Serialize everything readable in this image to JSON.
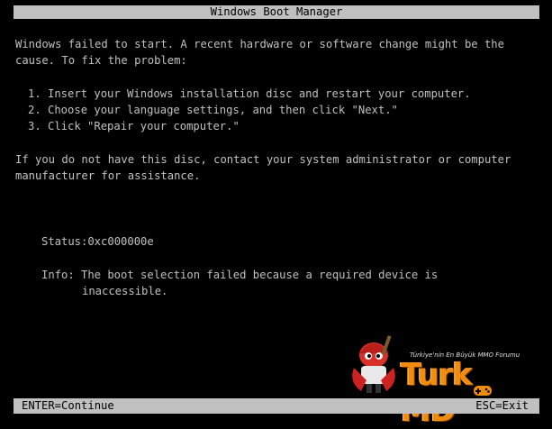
{
  "title": "Windows Boot Manager",
  "message": {
    "line1": "Windows failed to start. A recent hardware or software change might be the",
    "line2": "cause. To fix the problem:"
  },
  "steps": [
    "1. Insert your Windows installation disc and restart your computer.",
    "2. Choose your language settings, and then click \"Next.\"",
    "3. Click \"Repair your computer.\""
  ],
  "no_disc": {
    "line1": "If you do not have this disc, contact your system administrator or computer",
    "line2": "manufacturer for assistance."
  },
  "status": {
    "label": "Status:",
    "code": "0xc000000e"
  },
  "info": {
    "label": "Info:",
    "line1": "The boot selection failed because a required device is",
    "line2": "inaccessible."
  },
  "footer": {
    "left": "ENTER=Continue",
    "right": "ESC=Exit"
  },
  "watermark": {
    "brand_left": "Turk",
    "brand_right": "MD",
    "tagline": "Türkiye'nin En Büyük MMO Forumu"
  },
  "colors": {
    "background": "#000000",
    "text": "#c0c0c0",
    "bar": "#c0c0c0",
    "bar_text": "#000000",
    "watermark_orange": "#f28c0f"
  }
}
